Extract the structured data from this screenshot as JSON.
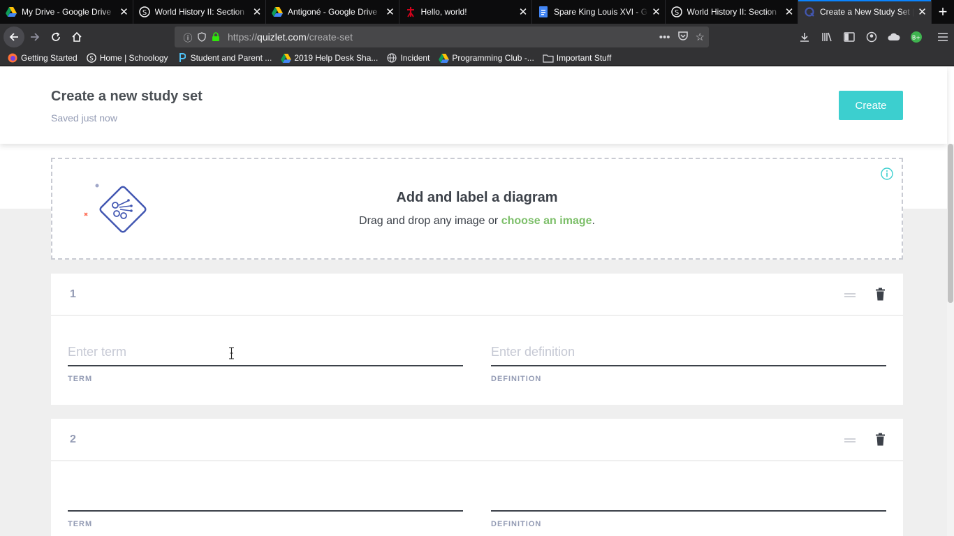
{
  "browser": {
    "tabs": [
      {
        "title": "My Drive - Google Drive",
        "icon": "google-drive-icon",
        "active": false
      },
      {
        "title": "World History II: Section",
        "icon": "schoology-icon",
        "active": false
      },
      {
        "title": "Antigoné - Google Drive",
        "icon": "google-drive-icon",
        "active": false
      },
      {
        "title": "Hello, world!",
        "icon": "red-figure-icon",
        "active": false
      },
      {
        "title": "Spare King Louis XVI - G",
        "icon": "google-docs-icon",
        "active": false
      },
      {
        "title": "World History II: Section",
        "icon": "schoology-icon",
        "active": false
      },
      {
        "title": "Create a New Study Set |",
        "icon": "quizlet-icon",
        "active": true
      }
    ],
    "url_prefix": "https://",
    "url_host": "quizlet.com",
    "url_path": "/create-set",
    "bookmarks": [
      {
        "label": "Getting Started",
        "icon": "firefox-icon"
      },
      {
        "label": "Home | Schoology",
        "icon": "schoology-icon"
      },
      {
        "label": "Student and Parent ...",
        "icon": "powerschool-icon"
      },
      {
        "label": "2019 Help Desk Sha...",
        "icon": "google-drive-icon"
      },
      {
        "label": "Incident",
        "icon": "globe-icon"
      },
      {
        "label": "Programming Club -...",
        "icon": "google-drive-icon"
      },
      {
        "label": "Important Stuff",
        "icon": "folder-icon"
      }
    ]
  },
  "header": {
    "title": "Create a new study set",
    "status": "Saved just now",
    "create_label": "Create"
  },
  "diagram": {
    "title": "Add and label a diagram",
    "sub_before": "Drag and drop any image or ",
    "sub_link": "choose an image",
    "sub_after": "."
  },
  "cards": [
    {
      "number": "1",
      "term_placeholder": "Enter term",
      "definition_placeholder": "Enter definition",
      "term_label": "TERM",
      "definition_label": "DEFINITION"
    },
    {
      "number": "2",
      "term_placeholder": "",
      "definition_placeholder": "",
      "term_label": "TERM",
      "definition_label": "DEFINITION"
    }
  ],
  "colors": {
    "accent": "#3ccfcf",
    "link": "#7dbf6a",
    "tab_active_line": "#0a84ff"
  }
}
